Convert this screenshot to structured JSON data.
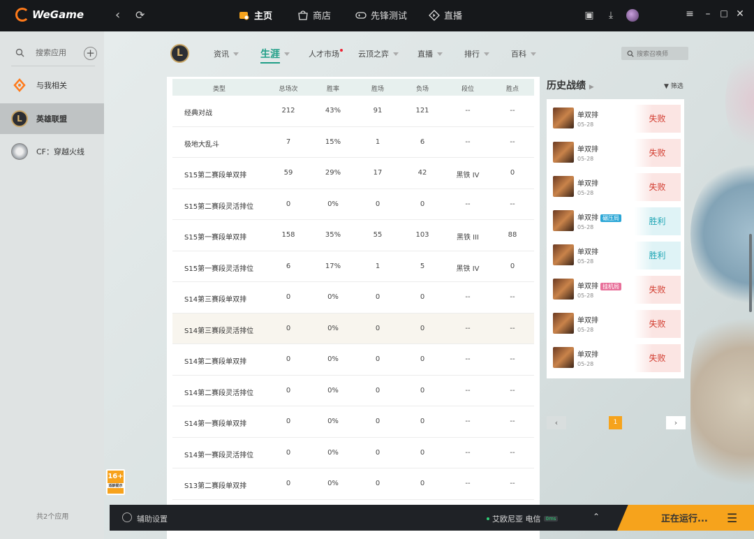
{
  "app": {
    "brand": "WeGame"
  },
  "topbar": {
    "tabs": [
      {
        "label": "主页"
      },
      {
        "label": "商店"
      },
      {
        "label": "先锋测试"
      },
      {
        "label": "直播"
      }
    ]
  },
  "sidebar": {
    "search_placeholder": "搜索应用",
    "items": [
      {
        "label": "与我相关",
        "icon": "related-icon"
      },
      {
        "label": "英雄联盟",
        "icon": "league-of-legends-icon"
      },
      {
        "label": "CF：穿越火线",
        "icon": "crossfire-icon"
      }
    ],
    "count_text": "共2个应用"
  },
  "game_nav": {
    "tabs": [
      {
        "label": "资讯"
      },
      {
        "label": "生涯"
      },
      {
        "label": "人才市场"
      },
      {
        "label": "云顶之弈"
      },
      {
        "label": "直播"
      },
      {
        "label": "排行"
      },
      {
        "label": "百科"
      }
    ],
    "search_placeholder": "搜索召唤师"
  },
  "stats_table": {
    "headers": [
      "类型",
      "总场次",
      "胜率",
      "胜场",
      "负场",
      "段位",
      "胜点"
    ],
    "rows": [
      [
        "经典对战",
        "212",
        "43%",
        "91",
        "121",
        "--",
        "--"
      ],
      [
        "极地大乱斗",
        "7",
        "15%",
        "1",
        "6",
        "--",
        "--"
      ],
      [
        "S15第二赛段单双排",
        "59",
        "29%",
        "17",
        "42",
        "黑铁 IV",
        "0"
      ],
      [
        "S15第二赛段灵活排位",
        "0",
        "0%",
        "0",
        "0",
        "--",
        "--"
      ],
      [
        "S15第一赛段单双排",
        "158",
        "35%",
        "55",
        "103",
        "黑铁 III",
        "88"
      ],
      [
        "S15第一赛段灵活排位",
        "6",
        "17%",
        "1",
        "5",
        "黑铁 IV",
        "0"
      ],
      [
        "S14第三赛段单双排",
        "0",
        "0%",
        "0",
        "0",
        "--",
        "--"
      ],
      [
        "S14第三赛段灵活排位",
        "0",
        "0%",
        "0",
        "0",
        "--",
        "--"
      ],
      [
        "S14第二赛段单双排",
        "0",
        "0%",
        "0",
        "0",
        "--",
        "--"
      ],
      [
        "S14第二赛段灵活排位",
        "0",
        "0%",
        "0",
        "0",
        "--",
        "--"
      ],
      [
        "S14第一赛段单双排",
        "0",
        "0%",
        "0",
        "0",
        "--",
        "--"
      ],
      [
        "S14第一赛段灵活排位",
        "0",
        "0%",
        "0",
        "0",
        "--",
        "--"
      ],
      [
        "S13第二赛段单双排",
        "0",
        "0%",
        "0",
        "0",
        "--",
        "--"
      ]
    ]
  },
  "history": {
    "title": "历史战绩",
    "filter_label": "筛选",
    "matches": [
      {
        "mode": "单双排",
        "badge": "",
        "date": "05-28",
        "result": "失败",
        "win": false
      },
      {
        "mode": "单双排",
        "badge": "",
        "date": "05-28",
        "result": "失败",
        "win": false
      },
      {
        "mode": "单双排",
        "badge": "",
        "date": "05-28",
        "result": "失败",
        "win": false
      },
      {
        "mode": "单双排",
        "badge": "碾压局",
        "badge_color": "#2aa6d6",
        "date": "05-28",
        "result": "胜利",
        "win": true
      },
      {
        "mode": "单双排",
        "badge": "",
        "date": "05-28",
        "result": "胜利",
        "win": true
      },
      {
        "mode": "单双排",
        "badge": "挂机局",
        "badge_color": "#e8709a",
        "date": "05-28",
        "result": "失败",
        "win": false
      },
      {
        "mode": "单双排",
        "badge": "",
        "date": "05-28",
        "result": "失败",
        "win": false
      },
      {
        "mode": "单双排",
        "badge": "",
        "date": "05-28",
        "result": "失败",
        "win": false
      }
    ],
    "pagination": {
      "current": "1"
    }
  },
  "age_rating": {
    "label": "16+",
    "sub": "适龄提示"
  },
  "bottombar": {
    "assist_label": "辅助设置",
    "server": "艾欧尼亚 电信",
    "ping": "0ms",
    "running_label": "正在运行..."
  },
  "colors": {
    "accent": "#1e9e86",
    "running": "#f6a31c",
    "brand": "#ff7a1a",
    "lose": "#d23b2e",
    "win": "#1ea5b4"
  }
}
